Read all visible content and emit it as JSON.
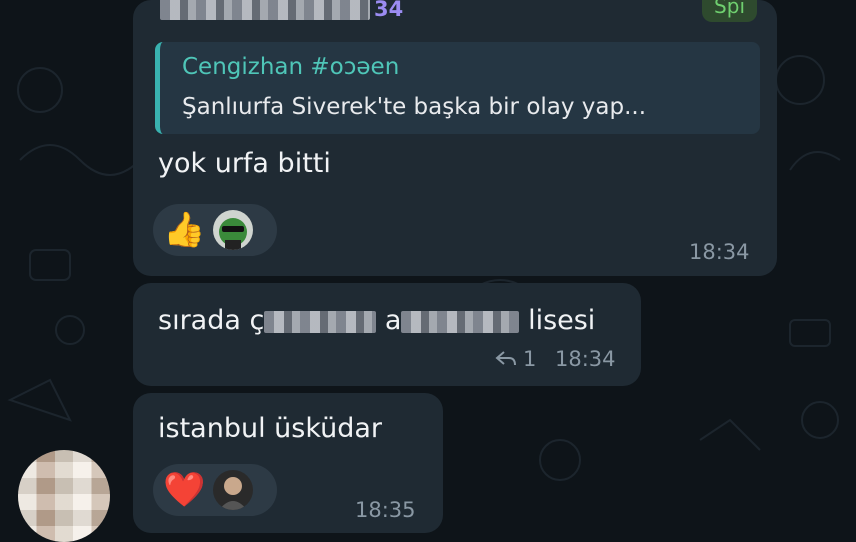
{
  "chat": {
    "message1": {
      "sender_suffix": "34",
      "role": "Spi",
      "quote_name": "Cengizhan #oɔəen",
      "quote_text": "Şanlıurfa Siverek'te başka bir olay yap...",
      "text": "yok urfa bitti",
      "reactions": [
        {
          "type": "thumbs-up",
          "glyph": "👍"
        },
        {
          "type": "frog-avatar"
        }
      ],
      "time": "18:34"
    },
    "message2": {
      "text_start": "sırada ç",
      "text_mid": "a",
      "text_end": "lisesi",
      "reply_count": "1",
      "time": "18:34"
    },
    "message3": {
      "text": "istanbul üsküdar",
      "reactions": [
        {
          "type": "heart",
          "glyph": "❤️"
        },
        {
          "type": "user-avatar"
        }
      ],
      "time": "18:35"
    }
  },
  "colors": {
    "background": "#0e1419",
    "bubble": "#1f2a33",
    "sender": "#9b8cf2",
    "quote_accent": "#39b2b0",
    "role_text": "#6fcf6f"
  }
}
